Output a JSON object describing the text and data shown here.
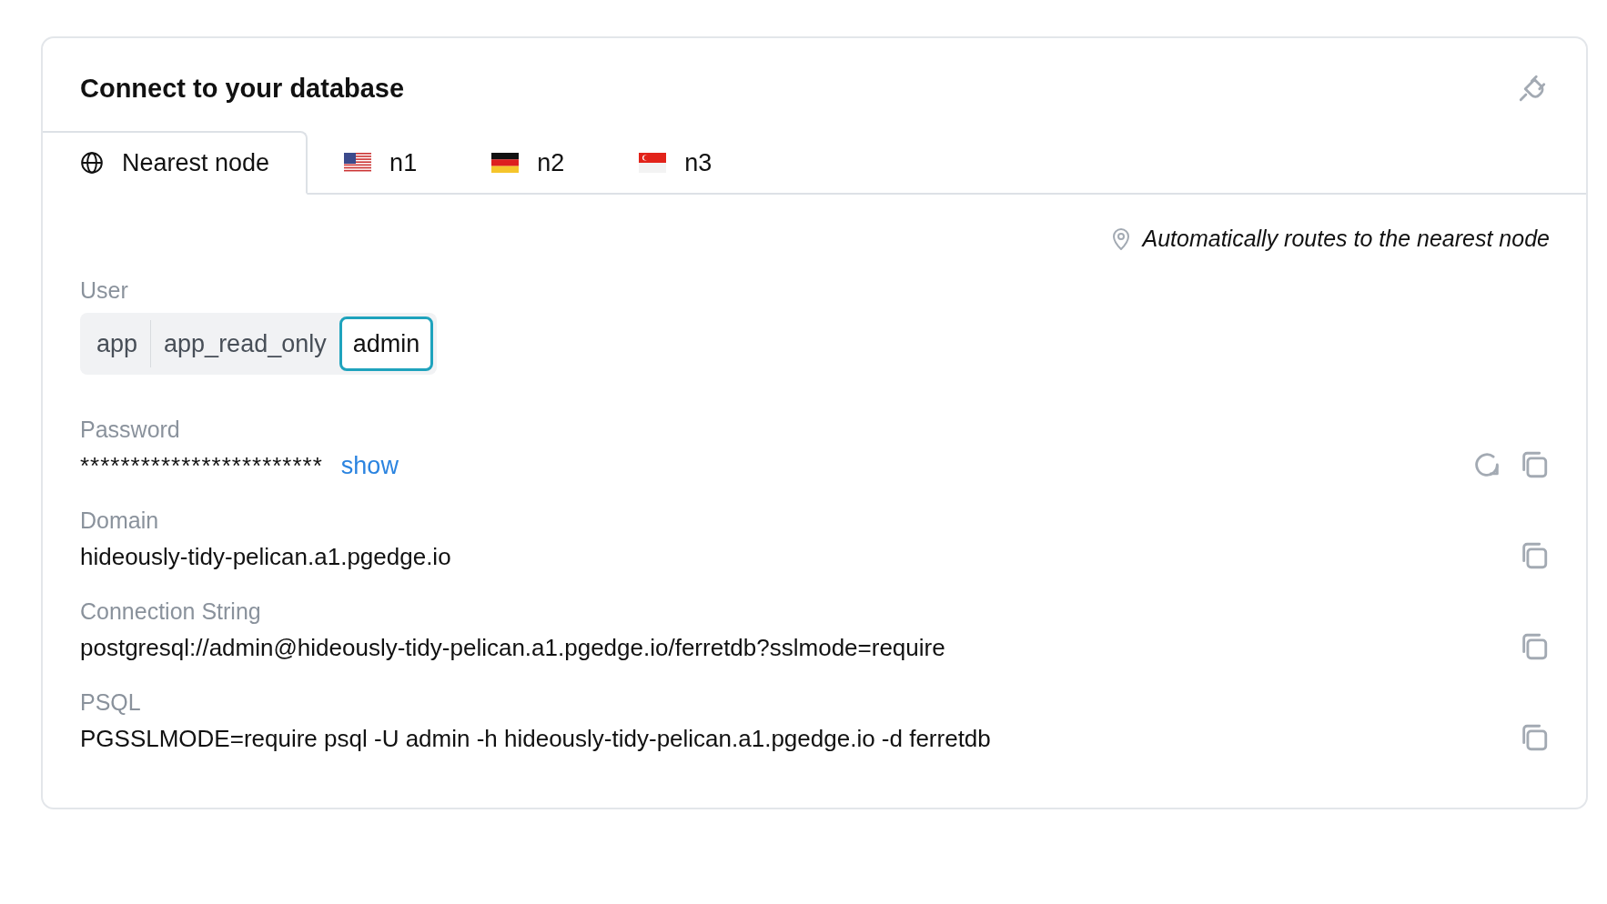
{
  "card": {
    "title": "Connect to your database"
  },
  "tabs": [
    {
      "label": "Nearest node",
      "kind": "globe",
      "selected": true
    },
    {
      "label": "n1",
      "kind": "flag-us",
      "selected": false
    },
    {
      "label": "n2",
      "kind": "flag-de",
      "selected": false
    },
    {
      "label": "n3",
      "kind": "flag-sg",
      "selected": false
    }
  ],
  "note": "Automatically routes to the nearest node",
  "user": {
    "label": "User",
    "options": [
      {
        "label": "app",
        "selected": false
      },
      {
        "label": "app_read_only",
        "selected": false
      },
      {
        "label": "admin",
        "selected": true
      }
    ]
  },
  "fields": [
    {
      "label": "Password",
      "value": "************************",
      "kind": "secret",
      "action": "show"
    },
    {
      "label": "Domain",
      "value": "hideously-tidy-pelican.a1.pgedge.io",
      "kind": "text"
    },
    {
      "label": "Connection String",
      "value": "postgresql://admin@hideously-tidy-pelican.a1.pgedge.io/ferretdb?sslmode=require",
      "kind": "text"
    },
    {
      "label": "PSQL",
      "value": "PGSSLMODE=require psql -U admin -h hideously-tidy-pelican.a1.pgedge.io -d ferretdb",
      "kind": "text"
    }
  ]
}
